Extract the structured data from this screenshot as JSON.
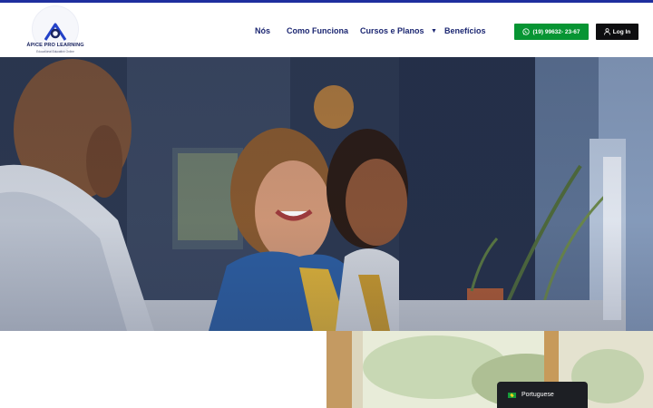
{
  "colors": {
    "accent_bar": "#1f2f9e",
    "nav_text": "#1c2772",
    "whatsapp_button": "#079533",
    "login_button": "#0e0e10",
    "language_bar": "#1d1f24"
  },
  "logo": {
    "title": "ÁPICE PRO LEARNING",
    "subtitle": "Educational Education Online"
  },
  "nav": {
    "items": [
      {
        "label": "Nós"
      },
      {
        "label": "Como Funciona"
      },
      {
        "label": "Cursos e Planos",
        "icon": "caret-down-icon"
      },
      {
        "label": "Benefícios"
      }
    ]
  },
  "header_buttons": {
    "whatsapp": {
      "label": "(19) 99632- 23-67",
      "icon": "whatsapp-icon"
    },
    "login": {
      "label": "Log In",
      "icon": "user-icon"
    }
  },
  "language_switcher": {
    "label": "Portuguese",
    "icon": "brazil-flag-icon"
  }
}
